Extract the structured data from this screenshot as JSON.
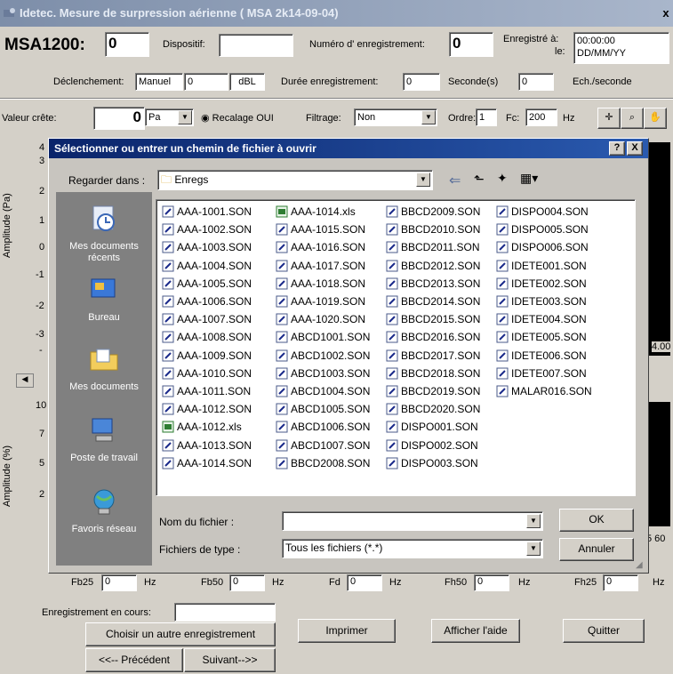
{
  "window": {
    "title": "Idetec. Mesure de surpression aérienne ( MSA 2k14-09-04)",
    "close": "x"
  },
  "header": {
    "model": "MSA1200:",
    "model_value": "0",
    "device_label": "Dispositif:",
    "device_value": "",
    "record_num_label": "Numéro d' enregistrement:",
    "record_num_value": "0",
    "recorded_at_label": "Enregistré à:",
    "recorded_on_label": "le:",
    "recorded_time": "00:00:00",
    "recorded_date": "DD/MM/YY",
    "trigger_label": "Déclenchement:",
    "trigger_value": "Manuel",
    "trigger_level": "0",
    "trigger_unit": "dBL",
    "duration_label": "Durée enregistrement:",
    "duration_value": "0",
    "duration_unit": "Seconde(s)",
    "rate_value": "0",
    "rate_unit": "Ech./seconde"
  },
  "toolbar": {
    "peak_label": "Valeur crête:",
    "peak_value": "0",
    "peak_unit": "Pa",
    "recalage_label": "Recalage OUI",
    "filter_label": "Filtrage:",
    "filter_value": "Non",
    "order_label": "Ordre:",
    "order_value": "1",
    "fc_label": "Fc:",
    "fc_value": "200",
    "fc_unit": "Hz"
  },
  "graph1": {
    "ylabel": "Amplitude (Pa)",
    "yticks": [
      "4",
      "3",
      "2",
      "1",
      "0",
      "-1",
      "-2",
      "-3",
      "-"
    ],
    "right_value": "4.00"
  },
  "graph2": {
    "ylabel": "Amplitude (%)",
    "yticks": [
      "10",
      "7",
      "5",
      "2"
    ],
    "right_value": "5 60"
  },
  "bands": [
    {
      "label": "Fb25",
      "value": "0",
      "unit": "Hz"
    },
    {
      "label": "Fb50",
      "value": "0",
      "unit": "Hz"
    },
    {
      "label": "Fd",
      "value": "0",
      "unit": "Hz"
    },
    {
      "label": "Fh50",
      "value": "0",
      "unit": "Hz"
    },
    {
      "label": "Fh25",
      "value": "0",
      "unit": "Hz"
    }
  ],
  "footer": {
    "current_label": "Enregistrement en cours:",
    "current_value": "",
    "choose_btn": "Choisir un autre enregistrement",
    "print_btn": "Imprimer",
    "help_btn": "Afficher l'aide",
    "quit_btn": "Quitter",
    "prev_btn": "<<-- Précédent",
    "next_btn": "Suivant-->>"
  },
  "dialog": {
    "title": "Sélectionner ou entrer un chemin de fichier à ouvrir",
    "help_btn": "?",
    "close_btn": "X",
    "look_in_label": "Regarder dans :",
    "look_in_value": "Enregs",
    "places": [
      "Mes documents récents",
      "Bureau",
      "Mes documents",
      "Poste de travail",
      "Favoris réseau"
    ],
    "filename_label": "Nom du fichier :",
    "filename_value": "",
    "filetype_label": "Fichiers de type :",
    "filetype_value": "Tous les fichiers (*.*)",
    "ok_btn": "OK",
    "cancel_btn": "Annuler",
    "columns": [
      [
        "AAA-1001.SON",
        "AAA-1002.SON",
        "AAA-1003.SON",
        "AAA-1004.SON",
        "AAA-1005.SON",
        "AAA-1006.SON",
        "AAA-1007.SON",
        "AAA-1008.SON",
        "AAA-1009.SON",
        "AAA-1010.SON",
        "AAA-1011.SON",
        "AAA-1012.SON",
        "AAA-1012.xls",
        "AAA-1013.SON",
        "AAA-1014.SON"
      ],
      [
        "AAA-1014.xls",
        "AAA-1015.SON",
        "AAA-1016.SON",
        "AAA-1017.SON",
        "AAA-1018.SON",
        "AAA-1019.SON",
        "AAA-1020.SON",
        "ABCD1001.SON",
        "ABCD1002.SON",
        "ABCD1003.SON",
        "ABCD1004.SON",
        "ABCD1005.SON",
        "ABCD1006.SON",
        "ABCD1007.SON",
        "BBCD2008.SON"
      ],
      [
        "BBCD2009.SON",
        "BBCD2010.SON",
        "BBCD2011.SON",
        "BBCD2012.SON",
        "BBCD2013.SON",
        "BBCD2014.SON",
        "BBCD2015.SON",
        "BBCD2016.SON",
        "BBCD2017.SON",
        "BBCD2018.SON",
        "BBCD2019.SON",
        "BBCD2020.SON",
        "DISPO001.SON",
        "DISPO002.SON",
        "DISPO003.SON"
      ],
      [
        "DISPO004.SON",
        "DISPO005.SON",
        "DISPO006.SON",
        "IDETE001.SON",
        "IDETE002.SON",
        "IDETE003.SON",
        "IDETE004.SON",
        "IDETE005.SON",
        "IDETE006.SON",
        "IDETE007.SON",
        "MALAR016.SON"
      ]
    ]
  }
}
